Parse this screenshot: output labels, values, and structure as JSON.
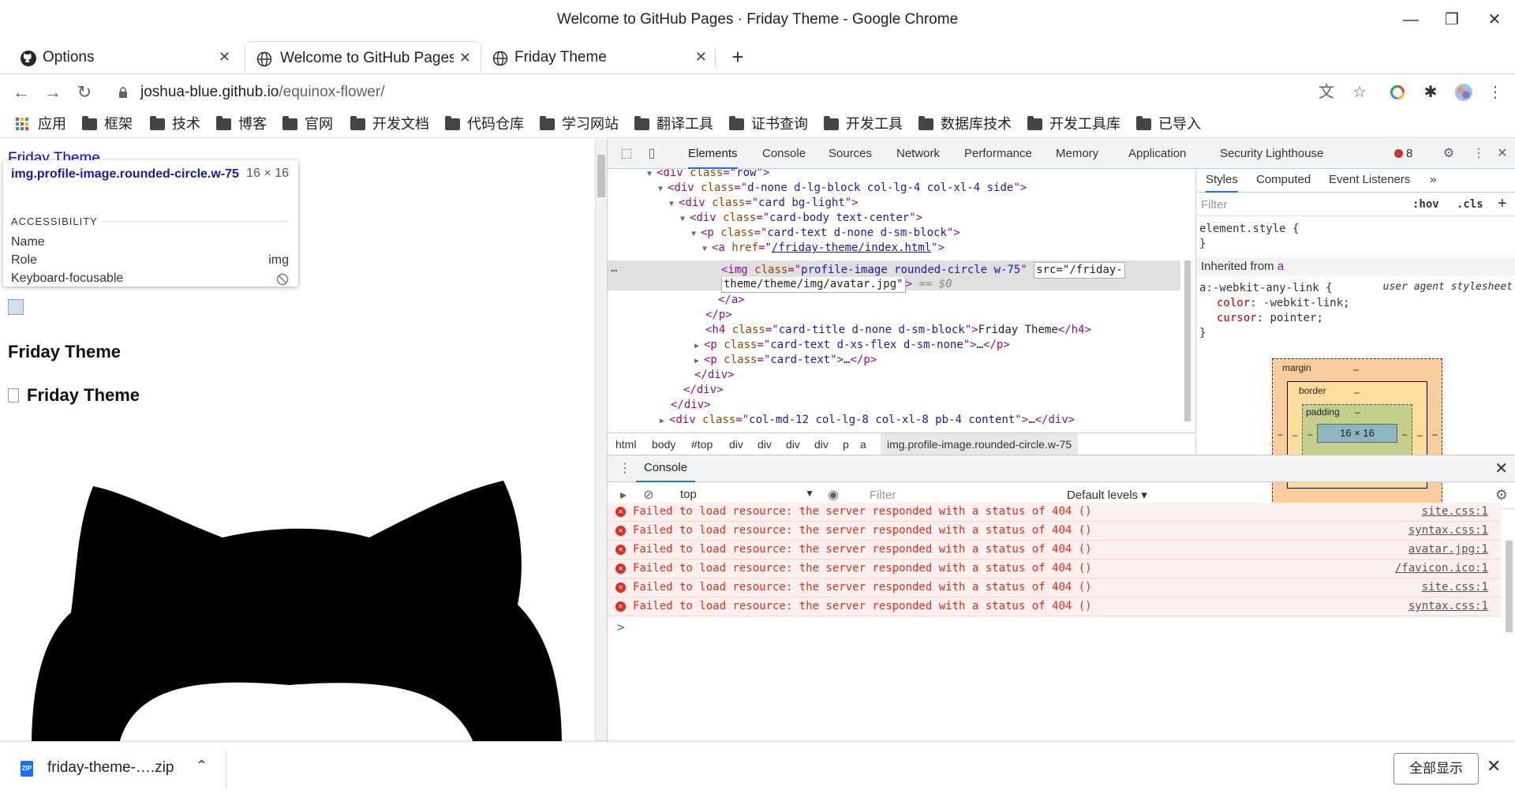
{
  "window": {
    "title": "Welcome to GitHub Pages · Friday Theme - Google Chrome",
    "minimize_glyph": "—",
    "restore_glyph": "❐",
    "close_glyph": "✕"
  },
  "tabs": [
    {
      "label": "Options",
      "icon": "github-icon"
    },
    {
      "label": "Welcome to GitHub Pages",
      "icon": "globe-icon"
    },
    {
      "label": "Friday Theme",
      "icon": "globe-icon"
    }
  ],
  "tab_close_glyph": "✕",
  "new_tab_glyph": "+",
  "address": {
    "host": "joshua-blue.github.io",
    "path": "/equinox-flower/"
  },
  "bookmarks": {
    "apps_label": "应用",
    "folders": [
      "框架",
      "技术",
      "博客",
      "官网",
      "开发文档",
      "代码仓库",
      "学习网站",
      "翻译工具",
      "证书查询",
      "开发工具",
      "数据库技术",
      "开发工具库",
      "已导入"
    ]
  },
  "page": {
    "top_link": "Friday Theme",
    "heading1": "Friday Theme",
    "heading2": "Friday Theme"
  },
  "inspect_tooltip": {
    "selector": "img.profile-image.rounded-circle.w-75",
    "size": "16 × 16",
    "section": "ACCESSIBILITY",
    "rows": [
      {
        "label": "Name",
        "value": ""
      },
      {
        "label": "Role",
        "value": "img"
      },
      {
        "label": "Keyboard-focusable",
        "value": ""
      }
    ]
  },
  "devtools": {
    "tabs": [
      "Elements",
      "Console",
      "Sources",
      "Network",
      "Performance",
      "Memory",
      "Application",
      "Security",
      "Lighthouse"
    ],
    "active_tab": "Elements",
    "error_count": "8",
    "breadcrumbs": [
      "html",
      "body",
      "#top",
      "div",
      "div",
      "div",
      "div",
      "p",
      "a",
      "img.profile-image.rounded-circle.w-75"
    ],
    "styles": {
      "tabs": [
        "Styles",
        "Computed",
        "Event Listeners"
      ],
      "more_glyph": "»",
      "filter_placeholder": "Filter",
      "hov": ":hov",
      "cls": ".cls",
      "element_style_open": "element.style {",
      "close_brace": "}",
      "inherited_prefix": "Inherited from ",
      "inherited_tag": "a",
      "rule_selector": "a:-webkit-any-link {",
      "rule_source": "user agent stylesheet",
      "decls": [
        {
          "prop": "color",
          "value": "-webkit-link;"
        },
        {
          "prop": "cursor",
          "value": "pointer;"
        }
      ]
    },
    "box_model": {
      "margin_label": "margin",
      "border_label": "border",
      "padding_label": "padding",
      "content": "16 × 16",
      "dash": "–"
    },
    "console": {
      "tab_label": "Console",
      "context": "top",
      "filter_placeholder": "Filter",
      "levels": "Default levels ▾",
      "messages": [
        {
          "text": "Failed to load resource: the server responded with a status of 404 ()",
          "source": "site.css:1"
        },
        {
          "text": "Failed to load resource: the server responded with a status of 404 ()",
          "source": "syntax.css:1"
        },
        {
          "text": "Failed to load resource: the server responded with a status of 404 ()",
          "source": "avatar.jpg:1"
        },
        {
          "text": "Failed to load resource: the server responded with a status of 404 ()",
          "source": "/favicon.ico:1"
        },
        {
          "text": "Failed to load resource: the server responded with a status of 404 ()",
          "source": "site.css:1"
        },
        {
          "text": "Failed to load resource: the server responded with a status of 404 ()",
          "source": "syntax.css:1"
        }
      ],
      "prompt": ">"
    }
  },
  "download": {
    "file_name": "friday-theme-….zip",
    "show_all": "全部显示"
  }
}
